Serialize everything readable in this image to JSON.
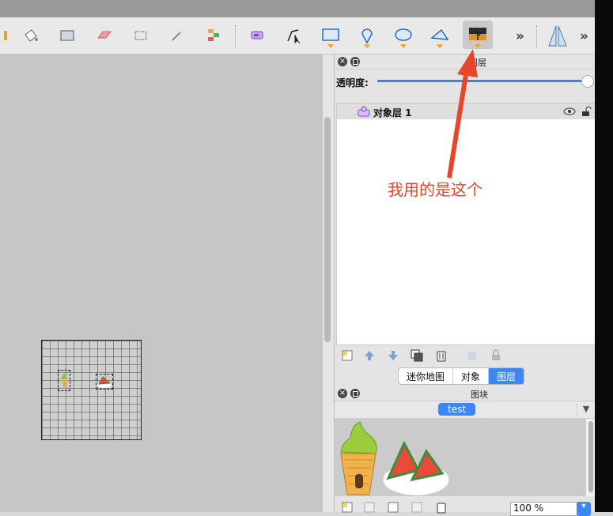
{
  "toolbar": {
    "tools": [
      {
        "name": "stamp-brush-icon"
      },
      {
        "name": "bucket-fill-icon"
      },
      {
        "name": "shape-fill-icon"
      },
      {
        "name": "eraser-icon"
      },
      {
        "name": "rect-select-icon"
      },
      {
        "name": "magic-wand-icon"
      },
      {
        "name": "select-same-tile-icon"
      },
      {
        "name": "select-objects-icon"
      },
      {
        "name": "edit-polygons-icon"
      },
      {
        "name": "insert-rectangle-icon"
      },
      {
        "name": "insert-point-icon"
      },
      {
        "name": "insert-ellipse-icon"
      },
      {
        "name": "insert-polygon-icon"
      },
      {
        "name": "insert-tile-icon"
      }
    ],
    "overflow_label": "»",
    "overflow_label_2": "»"
  },
  "layers_panel": {
    "title": "图层",
    "opacity_label": "透明度:",
    "opacity_value": 1.0,
    "layers": [
      {
        "name": "对象层 1"
      }
    ]
  },
  "bottom_tabs": [
    {
      "label": "迷你地图"
    },
    {
      "label": "对象"
    },
    {
      "label": "图层"
    }
  ],
  "tileset_panel": {
    "title": "图块",
    "tab_label": "test",
    "dropdown_arrow": "▼",
    "zoom": "100 %"
  },
  "annotation": {
    "text": "我用的是这个",
    "color": "#e8462a"
  },
  "colors": {
    "accent": "#3d87f5",
    "annotation_red": "#e8462a"
  }
}
